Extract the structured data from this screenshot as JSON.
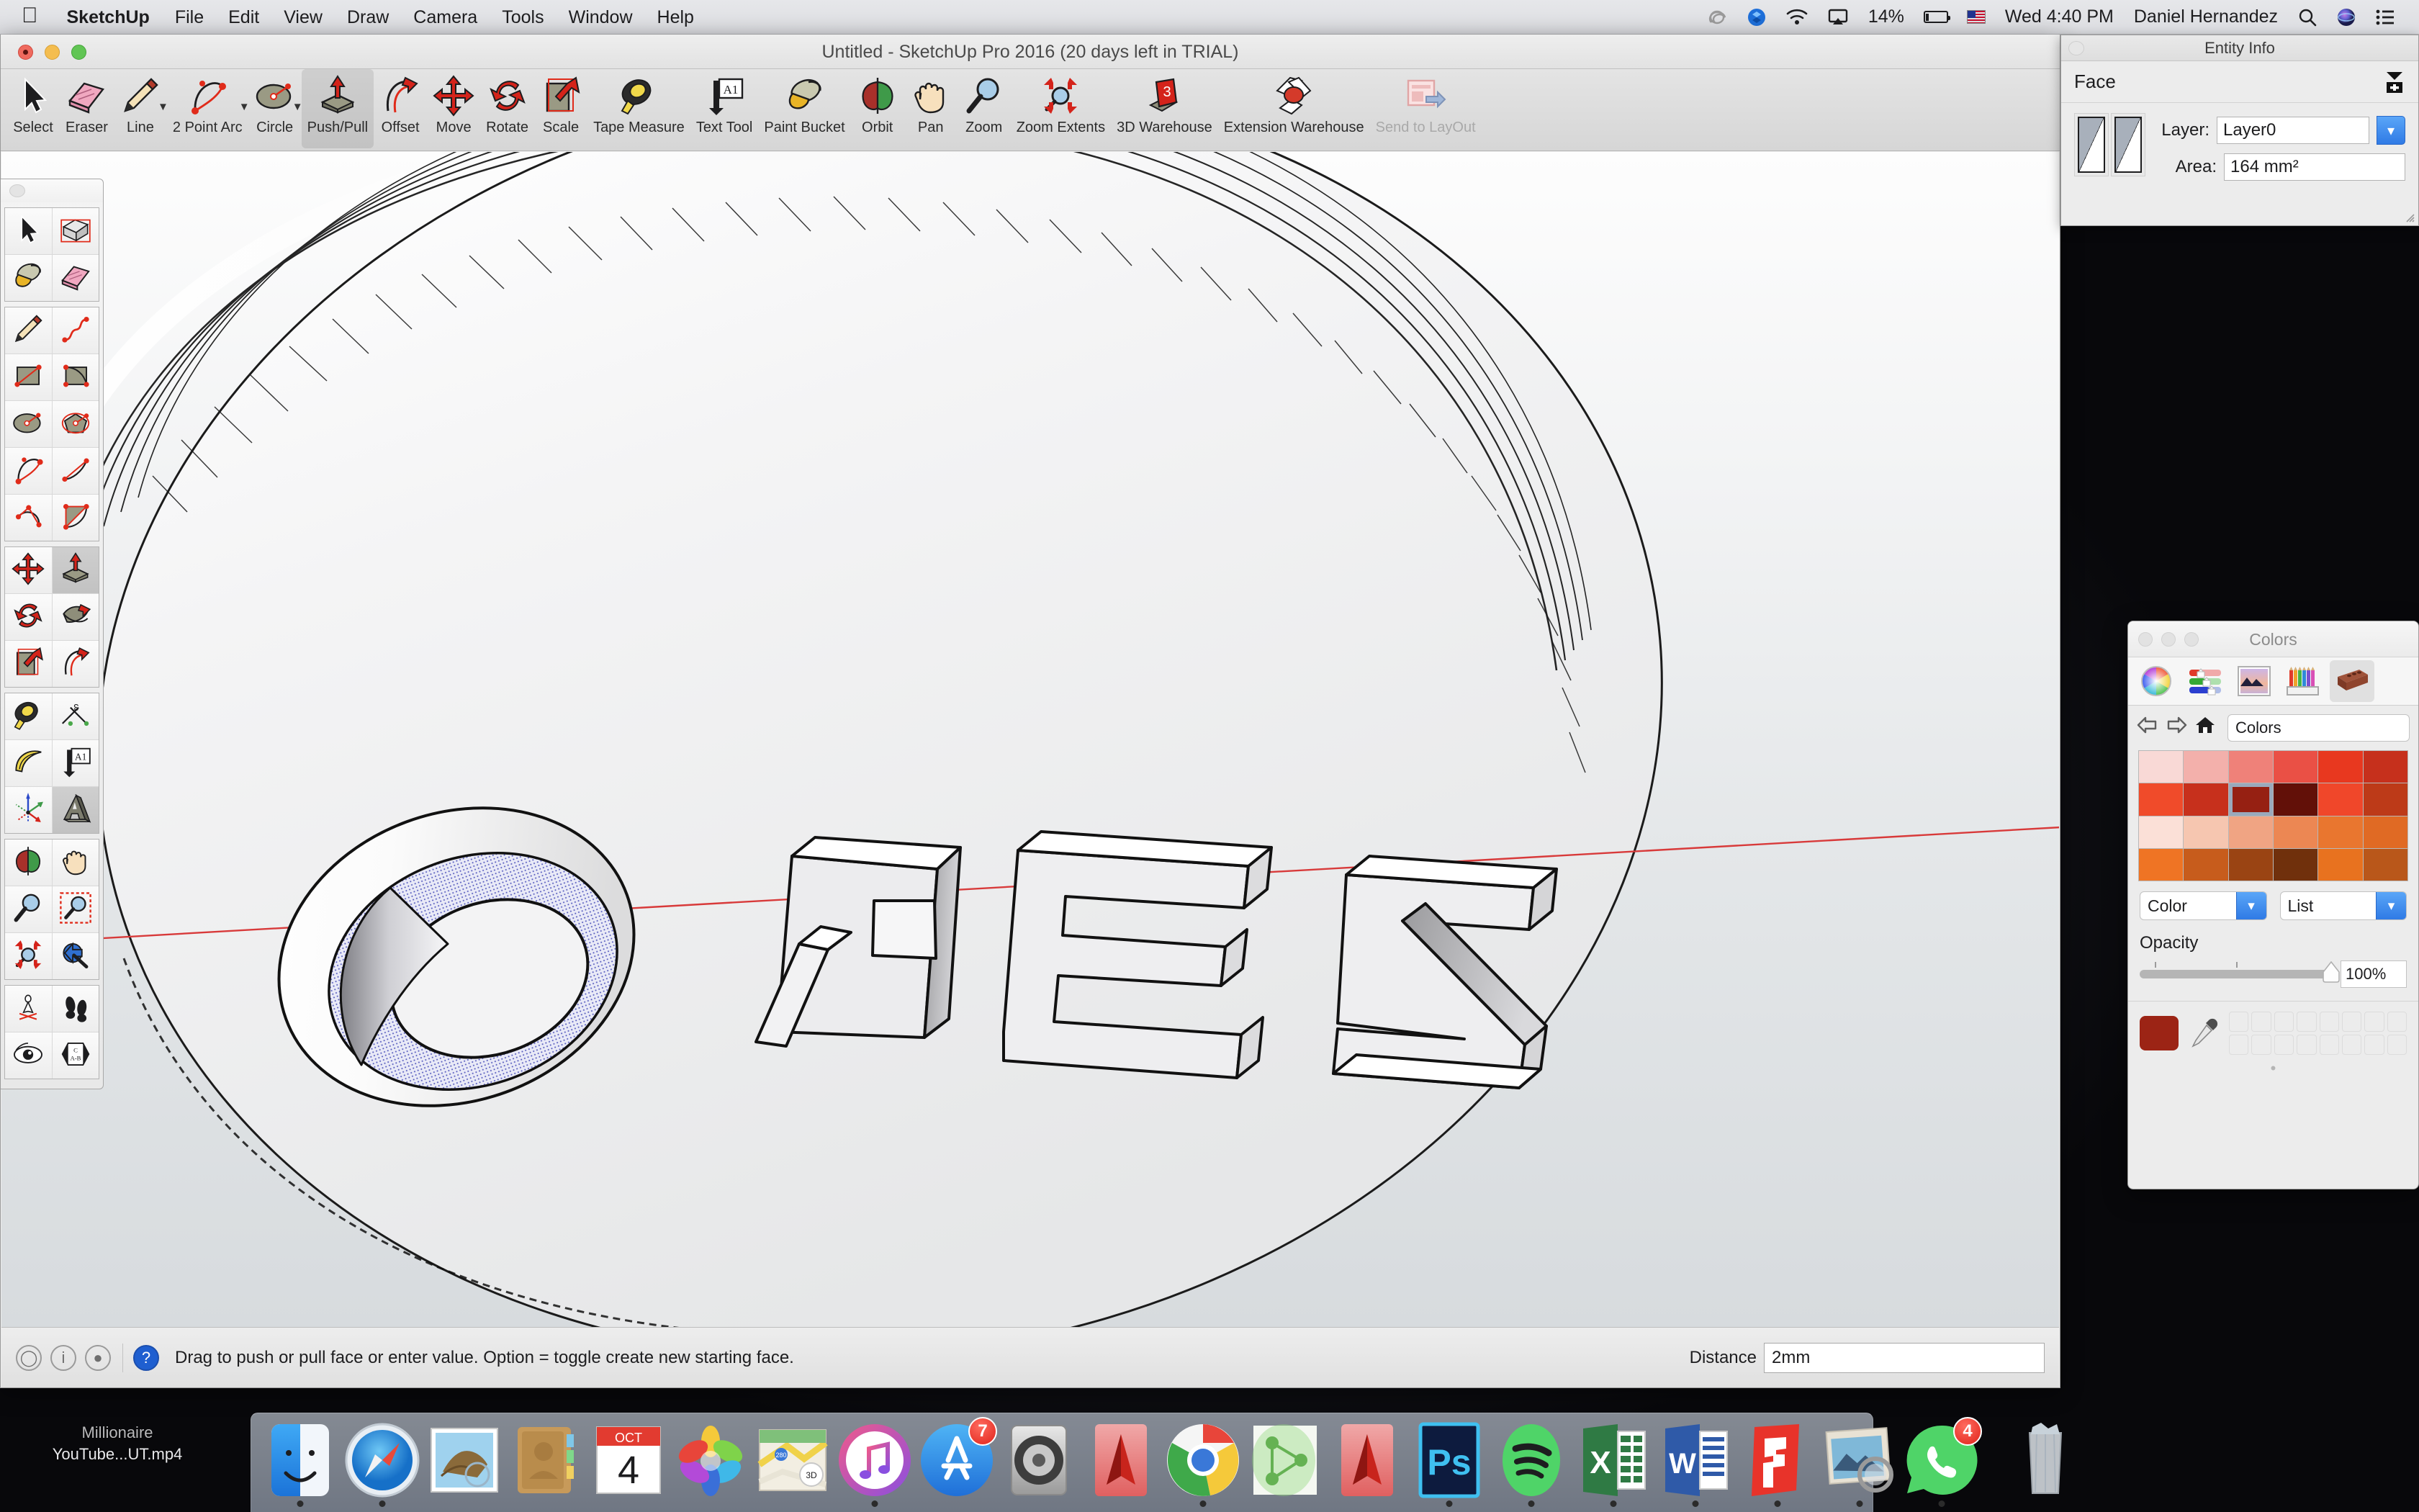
{
  "menubar": {
    "apple_icon": "apple-logo-icon",
    "app_name": "SketchUp",
    "items": [
      "File",
      "Edit",
      "View",
      "Draw",
      "Camera",
      "Tools",
      "Window",
      "Help"
    ],
    "status_icons": [
      "nvidia-icon",
      "dropbox-icon",
      "wifi-icon",
      "airplay-icon",
      "battery-icon",
      "us-flag-icon"
    ],
    "battery_percent": "14%",
    "clock": "Wed 4:40 PM",
    "user": "Daniel Hernandez",
    "right_icons": [
      "spotlight-search-icon",
      "siri-icon",
      "notification-center-icon"
    ]
  },
  "window": {
    "title": "Untitled - SketchUp Pro 2016 (20 days left in TRIAL)",
    "controls": [
      "close-button",
      "minimize-button",
      "zoom-button"
    ]
  },
  "toolbar": {
    "tools": [
      {
        "label": "Select",
        "icon": "select-arrow-icon",
        "active": false,
        "caret": false,
        "dim": false
      },
      {
        "label": "Eraser",
        "icon": "eraser-icon",
        "active": false,
        "caret": false,
        "dim": false
      },
      {
        "label": "Line",
        "icon": "pencil-line-icon",
        "active": false,
        "caret": true,
        "dim": false
      },
      {
        "label": "2 Point Arc",
        "icon": "two-point-arc-icon",
        "active": false,
        "caret": true,
        "dim": false
      },
      {
        "label": "Circle",
        "icon": "circle-icon",
        "active": false,
        "caret": true,
        "dim": false
      },
      {
        "label": "Push/Pull",
        "icon": "push-pull-icon",
        "active": true,
        "caret": false,
        "dim": false
      },
      {
        "label": "Offset",
        "icon": "offset-icon",
        "active": false,
        "caret": false,
        "dim": false
      },
      {
        "label": "Move",
        "icon": "move-icon",
        "active": false,
        "caret": false,
        "dim": false
      },
      {
        "label": "Rotate",
        "icon": "rotate-icon",
        "active": false,
        "caret": false,
        "dim": false
      },
      {
        "label": "Scale",
        "icon": "scale-icon",
        "active": false,
        "caret": false,
        "dim": false
      },
      {
        "label": "Tape Measure",
        "icon": "tape-measure-icon",
        "active": false,
        "caret": false,
        "dim": false
      },
      {
        "label": "Text Tool",
        "icon": "text-tool-icon",
        "active": false,
        "caret": false,
        "dim": false
      },
      {
        "label": "Paint Bucket",
        "icon": "paint-bucket-icon",
        "active": false,
        "caret": false,
        "dim": false
      },
      {
        "label": "Orbit",
        "icon": "orbit-icon",
        "active": false,
        "caret": false,
        "dim": false
      },
      {
        "label": "Pan",
        "icon": "pan-hand-icon",
        "active": false,
        "caret": false,
        "dim": false
      },
      {
        "label": "Zoom",
        "icon": "zoom-magnifier-icon",
        "active": false,
        "caret": false,
        "dim": false
      },
      {
        "label": "Zoom Extents",
        "icon": "zoom-extents-icon",
        "active": false,
        "caret": false,
        "dim": false
      },
      {
        "label": "3D Warehouse",
        "icon": "3d-warehouse-icon",
        "active": false,
        "caret": false,
        "dim": false
      },
      {
        "label": "Extension Warehouse",
        "icon": "extension-warehouse-icon",
        "active": false,
        "caret": false,
        "dim": false
      },
      {
        "label": "Send to LayOut",
        "icon": "send-to-layout-icon",
        "active": false,
        "caret": false,
        "dim": true
      }
    ]
  },
  "left_palette": {
    "groups": [
      {
        "cells": [
          {
            "icon": "select-arrow-icon",
            "selected": false
          },
          {
            "icon": "make-component-icon",
            "selected": false
          },
          {
            "icon": "paint-bucket-icon",
            "selected": false
          },
          {
            "icon": "eraser-icon",
            "selected": false
          }
        ]
      },
      {
        "cells": [
          {
            "icon": "pencil-line-icon",
            "selected": false
          },
          {
            "icon": "freehand-icon",
            "selected": false
          },
          {
            "icon": "rectangle-icon",
            "selected": false
          },
          {
            "icon": "rotated-rectangle-icon",
            "selected": false
          },
          {
            "icon": "circle-icon",
            "selected": false
          },
          {
            "icon": "polygon-icon",
            "selected": false
          },
          {
            "icon": "two-point-arc-icon",
            "selected": false
          },
          {
            "icon": "arc-icon",
            "selected": false
          },
          {
            "icon": "three-point-arc-icon",
            "selected": false
          },
          {
            "icon": "pie-icon",
            "selected": false
          }
        ]
      },
      {
        "cells": [
          {
            "icon": "move-icon",
            "selected": false
          },
          {
            "icon": "push-pull-icon",
            "selected": true
          },
          {
            "icon": "rotate-icon",
            "selected": false
          },
          {
            "icon": "follow-me-icon",
            "selected": false
          },
          {
            "icon": "scale-icon",
            "selected": false
          },
          {
            "icon": "offset-icon",
            "selected": false
          }
        ]
      },
      {
        "cells": [
          {
            "icon": "tape-measure-icon",
            "selected": false
          },
          {
            "icon": "dimension-icon",
            "selected": false
          },
          {
            "icon": "protractor-icon",
            "selected": false
          },
          {
            "icon": "text-tool-icon",
            "selected": false
          },
          {
            "icon": "axes-icon",
            "selected": false
          },
          {
            "icon": "3d-text-icon",
            "selected": true
          }
        ]
      },
      {
        "cells": [
          {
            "icon": "orbit-icon",
            "selected": false
          },
          {
            "icon": "pan-hand-icon",
            "selected": false
          },
          {
            "icon": "zoom-magnifier-icon",
            "selected": false
          },
          {
            "icon": "zoom-window-icon",
            "selected": false
          },
          {
            "icon": "zoom-extents-icon",
            "selected": false
          },
          {
            "icon": "previous-view-icon",
            "selected": false
          }
        ]
      },
      {
        "cells": [
          {
            "icon": "position-camera-icon",
            "selected": false
          },
          {
            "icon": "walk-icon",
            "selected": false
          },
          {
            "icon": "look-around-icon",
            "selected": false
          },
          {
            "icon": "section-plane-icon",
            "selected": false
          }
        ]
      }
    ]
  },
  "canvas": {
    "model_text": "ZERO",
    "description": "extruded-3d-text-on-disc",
    "axis_line_color": "#d83a3a",
    "selected_face_fill": "#b9bdea",
    "background_top": "#fdfdfd",
    "background_bottom": "#d7dbde"
  },
  "entity_info": {
    "title": "Entity Info",
    "type": "Face",
    "expand_icon": "expand-collapse-icon",
    "thumbnails": [
      "front-face-thumbnail",
      "back-face-thumbnail"
    ],
    "layer_label": "Layer:",
    "layer_value": "Layer0",
    "area_label": "Area:",
    "area_value": "164 mm²"
  },
  "colors_panel": {
    "title": "Colors",
    "tabs": [
      "color-wheel-icon",
      "color-sliders-icon",
      "image-palette-icon",
      "pencils-icon",
      "crayon-brick-icon"
    ],
    "active_tab_index": 4,
    "nav": {
      "back": "back-arrow-icon",
      "forward": "forward-arrow-icon",
      "home": "home-icon"
    },
    "search_value": "Colors",
    "swatches": [
      "#f9d9d6",
      "#f3b0ab",
      "#ef8179",
      "#ea5045",
      "#e8381f",
      "#c6301c",
      "#f04b2a",
      "#c7301c",
      "#962012",
      "#621008",
      "#f0472a",
      "#bd3a18",
      "#fbe0d7",
      "#f6c6b0",
      "#f0a483",
      "#ec8753",
      "#e9762f",
      "#e06a24",
      "#ef7424",
      "#c75c1c",
      "#9a4413",
      "#70300c",
      "#e8721f",
      "#b9571a"
    ],
    "selected_swatch_index": 8,
    "left_select_value": "Color",
    "right_select_value": "List",
    "opacity_label": "Opacity",
    "opacity_value": "100%",
    "current_color": "#9c2415",
    "eyedropper_icon": "eyedropper-icon"
  },
  "statusbar": {
    "icons": [
      "geo-location-icon",
      "credits-info-icon",
      "person-icon"
    ],
    "help_icon": "help-question-icon",
    "message": "Drag to push or pull face or enter value.  Option = toggle create new starting face.",
    "measurement_label": "Distance",
    "measurement_value": "2mm"
  },
  "desktop": {
    "file_line1": "Millionaire",
    "file_line2": "YouTube...UT.mp4"
  },
  "dock": {
    "items": [
      {
        "name": "finder",
        "running": true,
        "badge": null
      },
      {
        "name": "safari",
        "running": true,
        "badge": null
      },
      {
        "name": "mail",
        "running": false,
        "badge": null
      },
      {
        "name": "contacts",
        "running": false,
        "badge": null
      },
      {
        "name": "calendar",
        "running": false,
        "badge": null
      },
      {
        "name": "photos",
        "running": false,
        "badge": null
      },
      {
        "name": "maps",
        "running": false,
        "badge": null
      },
      {
        "name": "itunes",
        "running": true,
        "badge": null
      },
      {
        "name": "app-store",
        "running": false,
        "badge": "7"
      },
      {
        "name": "system-preferences",
        "running": false,
        "badge": null
      },
      {
        "name": "autocad-1",
        "running": false,
        "badge": null
      },
      {
        "name": "chrome",
        "running": true,
        "badge": null
      },
      {
        "name": "sketchup-viewer",
        "running": false,
        "badge": null
      },
      {
        "name": "autocad-2",
        "running": false,
        "badge": null
      },
      {
        "name": "photoshop",
        "running": true,
        "badge": null
      },
      {
        "name": "spotify",
        "running": true,
        "badge": null
      },
      {
        "name": "excel",
        "running": true,
        "badge": null
      },
      {
        "name": "word",
        "running": true,
        "badge": null
      },
      {
        "name": "sketchup",
        "running": true,
        "badge": null
      },
      {
        "name": "preview",
        "running": true,
        "badge": null
      },
      {
        "name": "whatsapp",
        "running": true,
        "badge": "4"
      }
    ],
    "trash": {
      "name": "trash",
      "full": true
    }
  }
}
